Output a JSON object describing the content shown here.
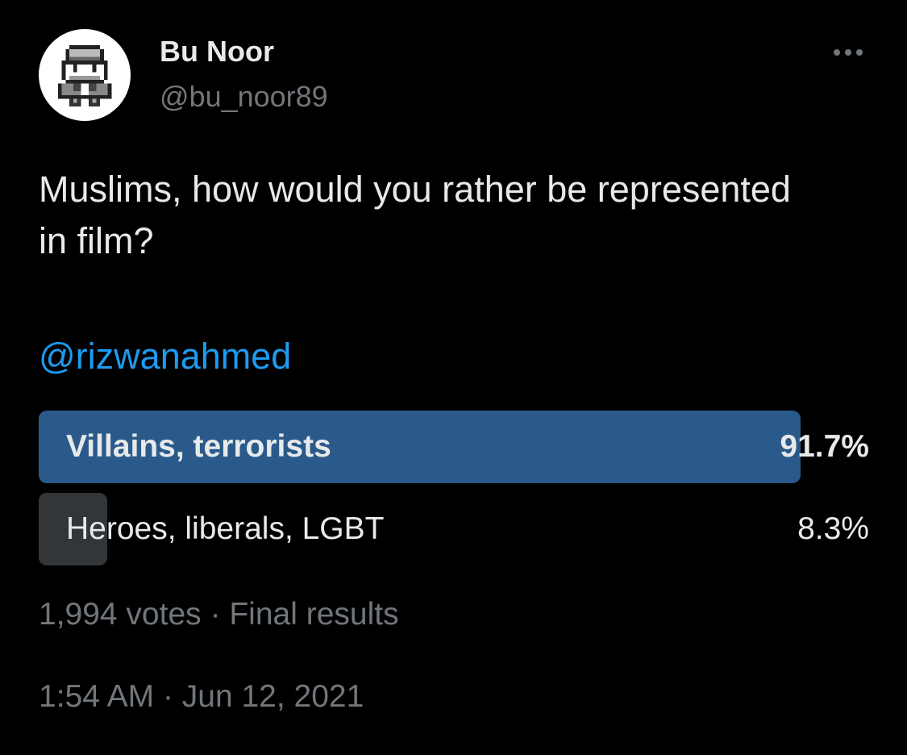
{
  "author": {
    "display_name": "Bu Noor",
    "handle": "@bu_noor89",
    "avatar_icon": "pixel-character-avatar"
  },
  "more_icon": "more-horizontal-icon",
  "tweet": {
    "text": "Muslims, how would you rather be represented\nin film?",
    "mention": "@rizwanahmed"
  },
  "poll": {
    "options": [
      {
        "label": "Villains, terrorists",
        "percent_text": "91.7%",
        "percent": 91.7,
        "winner": true,
        "fill_color": "#2a5a8a"
      },
      {
        "label": "Heroes, liberals, LGBT",
        "percent_text": "8.3%",
        "percent": 8.3,
        "winner": false,
        "fill_color": "#333639"
      }
    ],
    "votes": "1,994 votes",
    "separator": "·",
    "status": "Final results"
  },
  "timestamp": {
    "time": "1:54 AM",
    "separator": "·",
    "date": "Jun 12, 2021"
  },
  "colors": {
    "background": "#000000",
    "primary_text": "#e7e9ea",
    "secondary_text": "#71767b",
    "link": "#1d9bf0"
  }
}
